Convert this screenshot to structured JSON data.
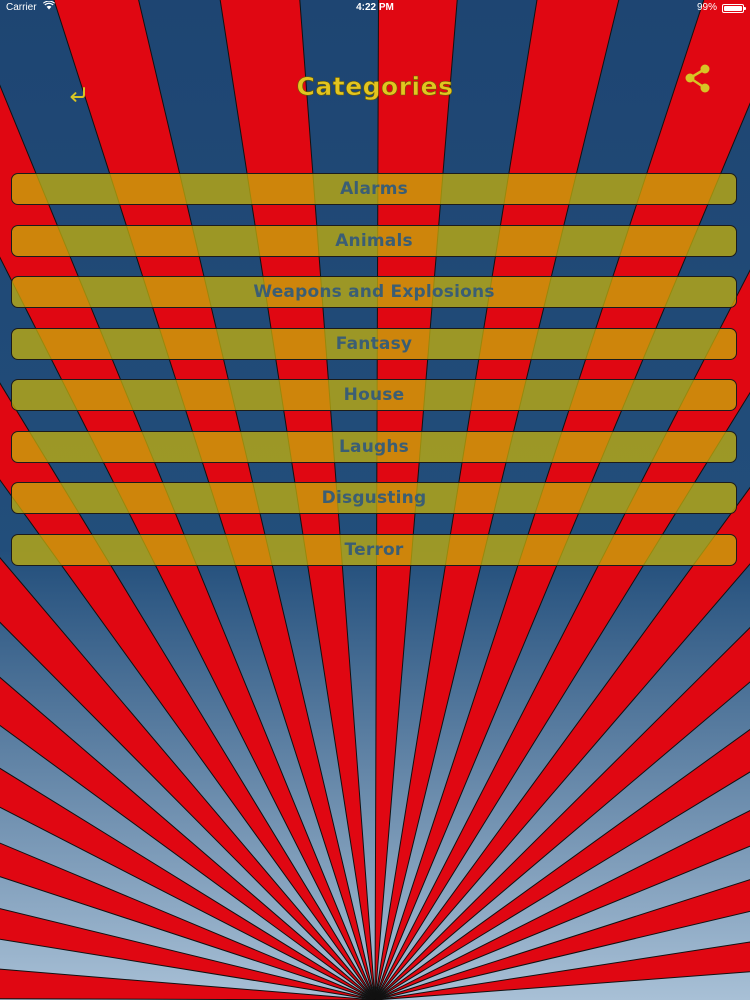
{
  "status_bar": {
    "carrier": "Carrier",
    "time": "4:22 PM",
    "battery": "99%",
    "battery_level": 0.99
  },
  "header": {
    "title": "Categories",
    "back_icon": "return-arrow-icon",
    "share_icon": "share-icon"
  },
  "categories": [
    {
      "label": "Alarms"
    },
    {
      "label": "Animals"
    },
    {
      "label": "Weapons and Explosions"
    },
    {
      "label": "Fantasy"
    },
    {
      "label": "House"
    },
    {
      "label": "Laughs"
    },
    {
      "label": "Disgusting"
    },
    {
      "label": "Terror"
    }
  ],
  "colors": {
    "stripe_red": "#e00712",
    "sky_top": "#1e4572",
    "sky_bottom": "#a8c0d6",
    "title_yellow": "#e3c520",
    "icon_yellow": "#d7c425",
    "button_text": "#3b5e74"
  }
}
